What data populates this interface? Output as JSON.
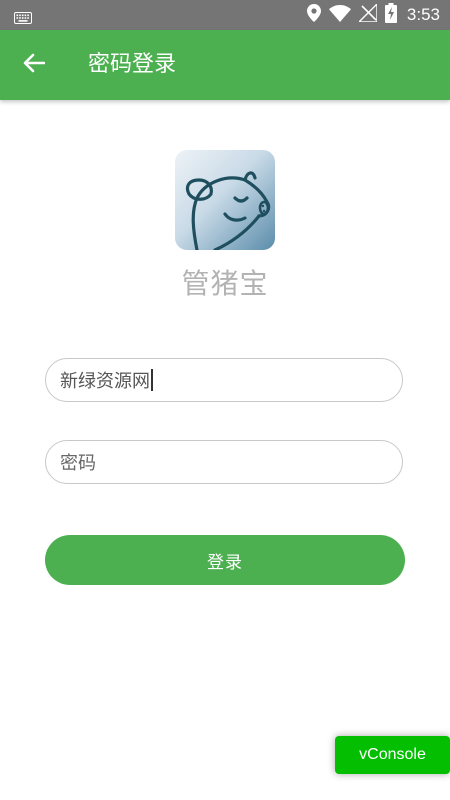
{
  "status_bar": {
    "time": "3:53",
    "icons": [
      "keyboard-icon",
      "location-icon",
      "wifi-icon",
      "signal-off-icon",
      "battery-charging-icon"
    ]
  },
  "app_bar": {
    "title": "密码登录",
    "background_color": "#4caf50",
    "back_icon": "arrow-left-icon"
  },
  "brand": {
    "app_name": "管猪宝",
    "logo_icon": "pig-logo-icon"
  },
  "form": {
    "username_value": "新绿资源网",
    "password_placeholder": "密码"
  },
  "actions": {
    "login_label": "登录",
    "accent_color": "#4caf50"
  },
  "debug": {
    "vconsole_label": "vConsole",
    "vconsole_color": "#04be02"
  }
}
